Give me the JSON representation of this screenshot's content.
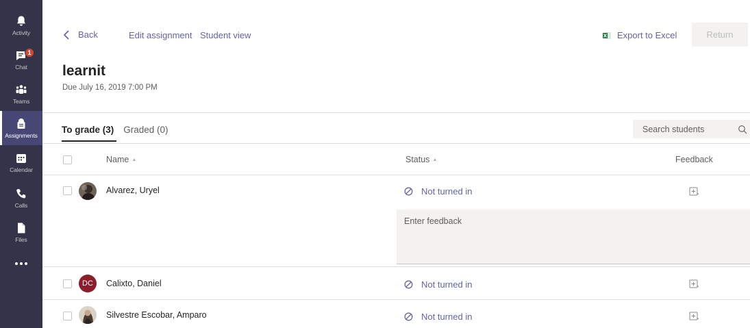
{
  "rail": {
    "items": [
      {
        "label": "Activity",
        "icon": "bell-icon"
      },
      {
        "label": "Chat",
        "icon": "chat-icon",
        "badge": "1"
      },
      {
        "label": "Teams",
        "icon": "teams-icon"
      },
      {
        "label": "Assignments",
        "icon": "assignments-icon",
        "active": true
      },
      {
        "label": "Calendar",
        "icon": "calendar-icon"
      },
      {
        "label": "Calls",
        "icon": "phone-icon"
      },
      {
        "label": "Files",
        "icon": "files-icon"
      }
    ]
  },
  "topbar": {
    "back_label": "Back",
    "edit_label": "Edit assignment",
    "student_view_label": "Student view",
    "export_label": "Export to Excel",
    "return_label": "Return"
  },
  "assignment": {
    "title": "learnit",
    "due": "Due July 16, 2019 7:00 PM"
  },
  "tabs": [
    {
      "label": "To grade (3)",
      "active": true
    },
    {
      "label": "Graded (0)",
      "active": false
    }
  ],
  "search": {
    "placeholder": "Search students"
  },
  "table": {
    "headers": {
      "name": "Name",
      "status": "Status",
      "feedback": "Feedback"
    },
    "rows": [
      {
        "name": "Alvarez, Uryel",
        "status": "Not turned in",
        "avatar": "photo"
      },
      {
        "name": "Calixto, Daniel",
        "status": "Not turned in",
        "avatar_initials": "DC"
      },
      {
        "name": "Silvestre Escobar, Amparo",
        "status": "Not turned in",
        "avatar": "photo"
      }
    ],
    "feedback_placeholder": "Enter feedback"
  },
  "colors": {
    "rail_bg": "#33344a",
    "accent": "#6264a7",
    "badge": "#cc4a31",
    "avatar_dc": "#8b1e2a"
  }
}
